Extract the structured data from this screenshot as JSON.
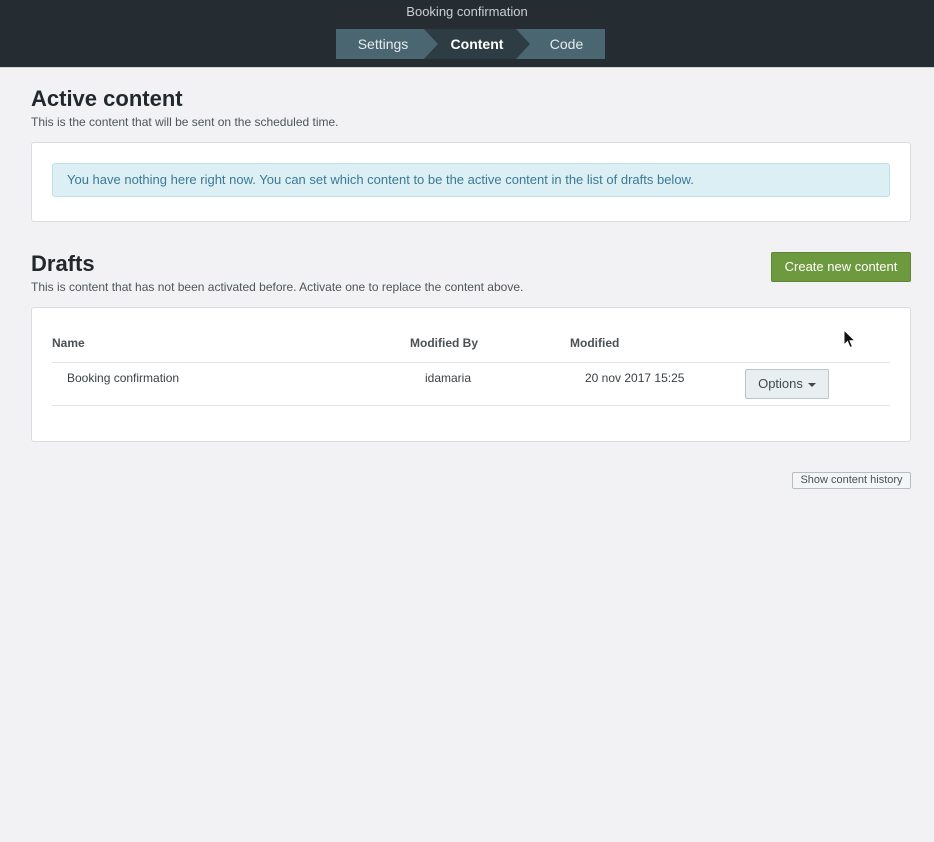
{
  "window": {
    "title": "Booking confirmation"
  },
  "stepper": {
    "steps": [
      {
        "label": "Settings"
      },
      {
        "label": "Content"
      },
      {
        "label": "Code"
      }
    ],
    "active": "Content"
  },
  "active_content": {
    "title": "Active content",
    "description": "This is the content that will be sent on the scheduled time.",
    "alert": "You have nothing here right now. You can set which content to be the active content in the list of drafts below."
  },
  "drafts": {
    "title": "Drafts",
    "description": "This is content that has not been activated before. Activate one to replace the content above.",
    "create_button": "Create new content",
    "columns": {
      "name": "Name",
      "modified_by": "Modified By",
      "modified": "Modified"
    },
    "rows": [
      {
        "name": "Booking confirmation",
        "modified_by": "idamaria",
        "modified": "20 nov 2017 15:25",
        "options_label": "Options"
      }
    ]
  },
  "footer": {
    "history_button": "Show content history"
  },
  "icons": {
    "options_caret": "caret-down-icon",
    "cursor": "mouse-pointer-icon"
  },
  "colors": {
    "topbar": "#262d32",
    "step": "#4a6670",
    "step_active": "#2e3c43",
    "primary_button": "#6e9a3f",
    "alert_bg": "#dceff5",
    "alert_text": "#3b7a93"
  }
}
